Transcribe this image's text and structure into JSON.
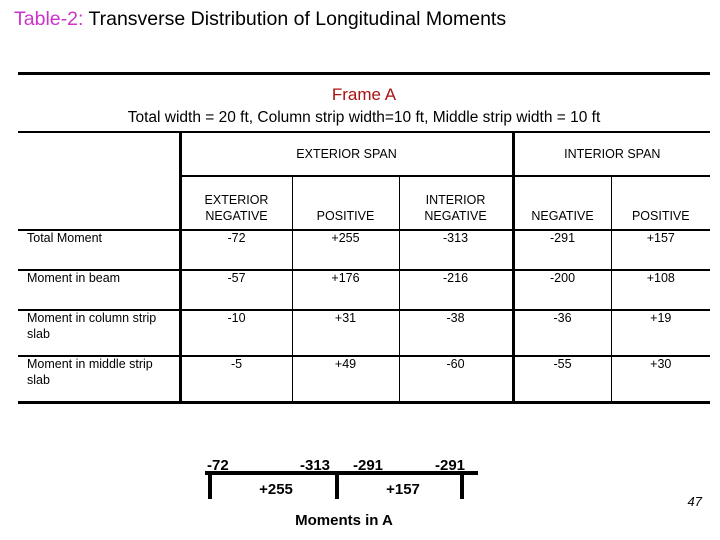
{
  "slide": {
    "title_accent": "Table-2:",
    "title_rest": " Transverse Distribution of Longitudinal Moments",
    "accent_color": "#cc33cc",
    "page_number": "47"
  },
  "table": {
    "frame_name": "Frame A",
    "frame_dimensions": "Total width = 20 ft, Column strip width=10 ft, Middle strip width = 10 ft",
    "frame_name_color": "#aa1111",
    "group_headers": [
      {
        "label": "",
        "span": 1
      },
      {
        "label": "EXTERIOR SPAN",
        "span": 3
      },
      {
        "label": "INTERIOR SPAN",
        "span": 2
      }
    ],
    "column_headers": [
      {
        "line1": "",
        "line2": ""
      },
      {
        "line1": "EXTERIOR",
        "line2": "NEGATIVE"
      },
      {
        "line1": "",
        "line2": "POSITIVE"
      },
      {
        "line1": "INTERIOR",
        "line2": "NEGATIVE"
      },
      {
        "line1": "",
        "line2": "NEGATIVE"
      },
      {
        "line1": "",
        "line2": "POSITIVE"
      }
    ],
    "rows": [
      {
        "label_line1": "Total Moment",
        "label_line2": "",
        "values": [
          "-72",
          "+255",
          "-313",
          "-291",
          "+157"
        ]
      },
      {
        "label_line1": "Moment in beam",
        "label_line2": "",
        "values": [
          "-57",
          "+176",
          "-216",
          "-200",
          "+108"
        ]
      },
      {
        "label_line1": "Moment in column",
        "label_line2": "strip slab",
        "values": [
          "-10",
          "+31",
          "-38",
          "-36",
          "+19"
        ]
      },
      {
        "label_line1": "Moment in middle",
        "label_line2": "strip slab",
        "values": [
          "-5",
          "+49",
          "-60",
          "-55",
          "+30"
        ]
      }
    ]
  },
  "diagram": {
    "caption": "Moments in A",
    "negative_labels": [
      "-72",
      "-313",
      "-291",
      "-291"
    ],
    "positive_labels": [
      "+255",
      "+157"
    ]
  }
}
